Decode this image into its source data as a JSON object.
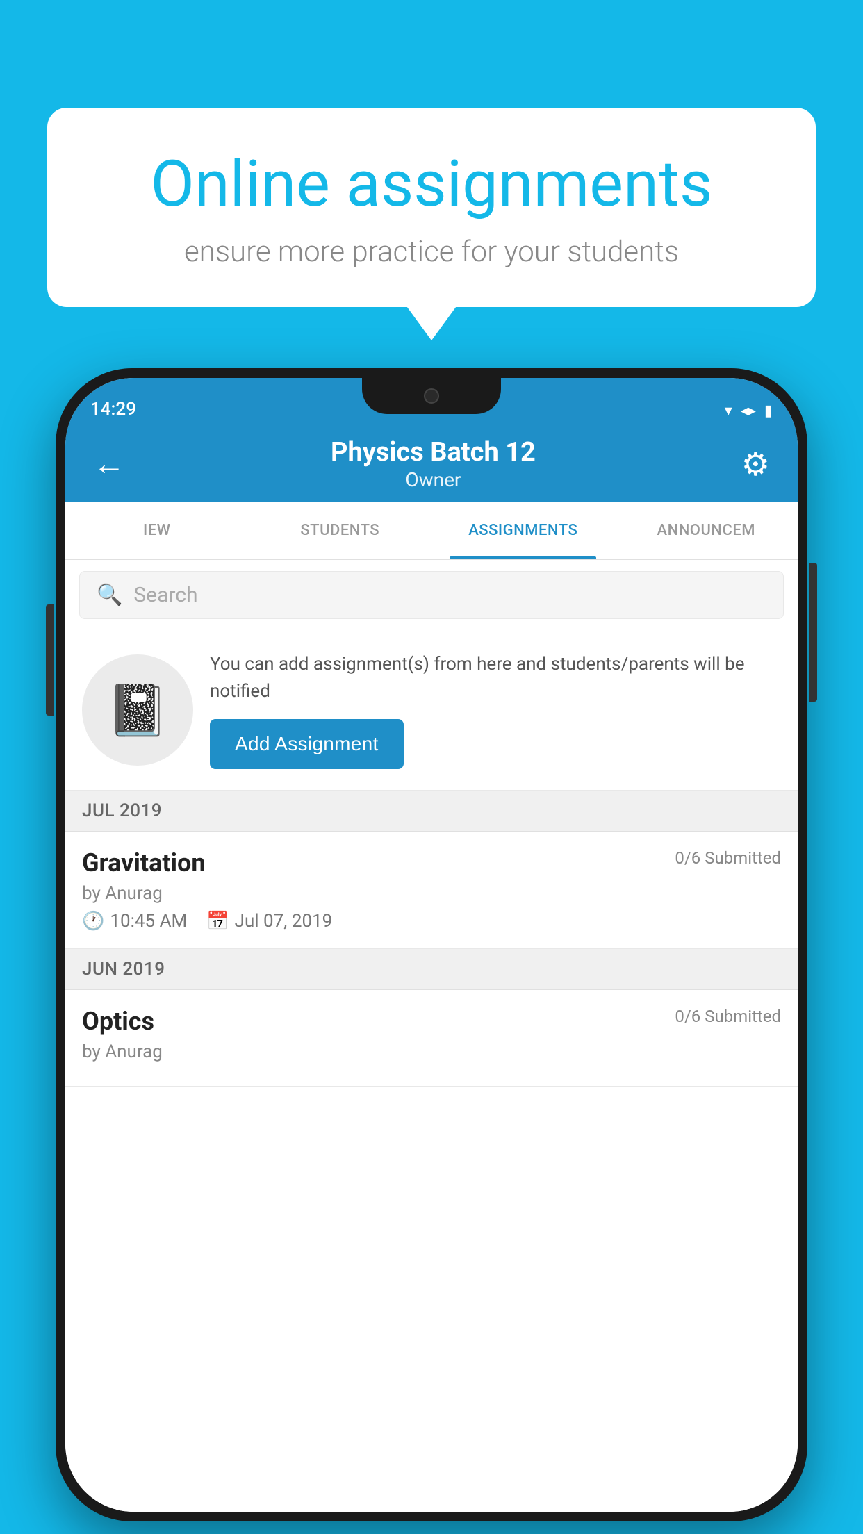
{
  "background_color": "#14b8e8",
  "speech_bubble": {
    "title": "Online assignments",
    "subtitle": "ensure more practice for your students"
  },
  "phone": {
    "status_bar": {
      "time": "14:29",
      "wifi_icon": "▾",
      "signal_icon": "◂▸",
      "battery_icon": "▮"
    },
    "app_bar": {
      "back_icon": "←",
      "title": "Physics Batch 12",
      "subtitle": "Owner",
      "settings_icon": "⚙"
    },
    "tabs": [
      {
        "label": "IEW",
        "active": false
      },
      {
        "label": "STUDENTS",
        "active": false
      },
      {
        "label": "ASSIGNMENTS",
        "active": true
      },
      {
        "label": "ANNOUNCEM",
        "active": false
      }
    ],
    "search": {
      "placeholder": "Search",
      "icon": "🔍"
    },
    "promo": {
      "description": "You can add assignment(s) from here and students/parents will be notified",
      "button_label": "Add Assignment"
    },
    "sections": [
      {
        "month_label": "JUL 2019",
        "assignments": [
          {
            "title": "Gravitation",
            "submitted": "0/6 Submitted",
            "by": "by Anurag",
            "time": "10:45 AM",
            "date": "Jul 07, 2019"
          }
        ]
      },
      {
        "month_label": "JUN 2019",
        "assignments": [
          {
            "title": "Optics",
            "submitted": "0/6 Submitted",
            "by": "by Anurag",
            "time": "",
            "date": ""
          }
        ]
      }
    ]
  }
}
